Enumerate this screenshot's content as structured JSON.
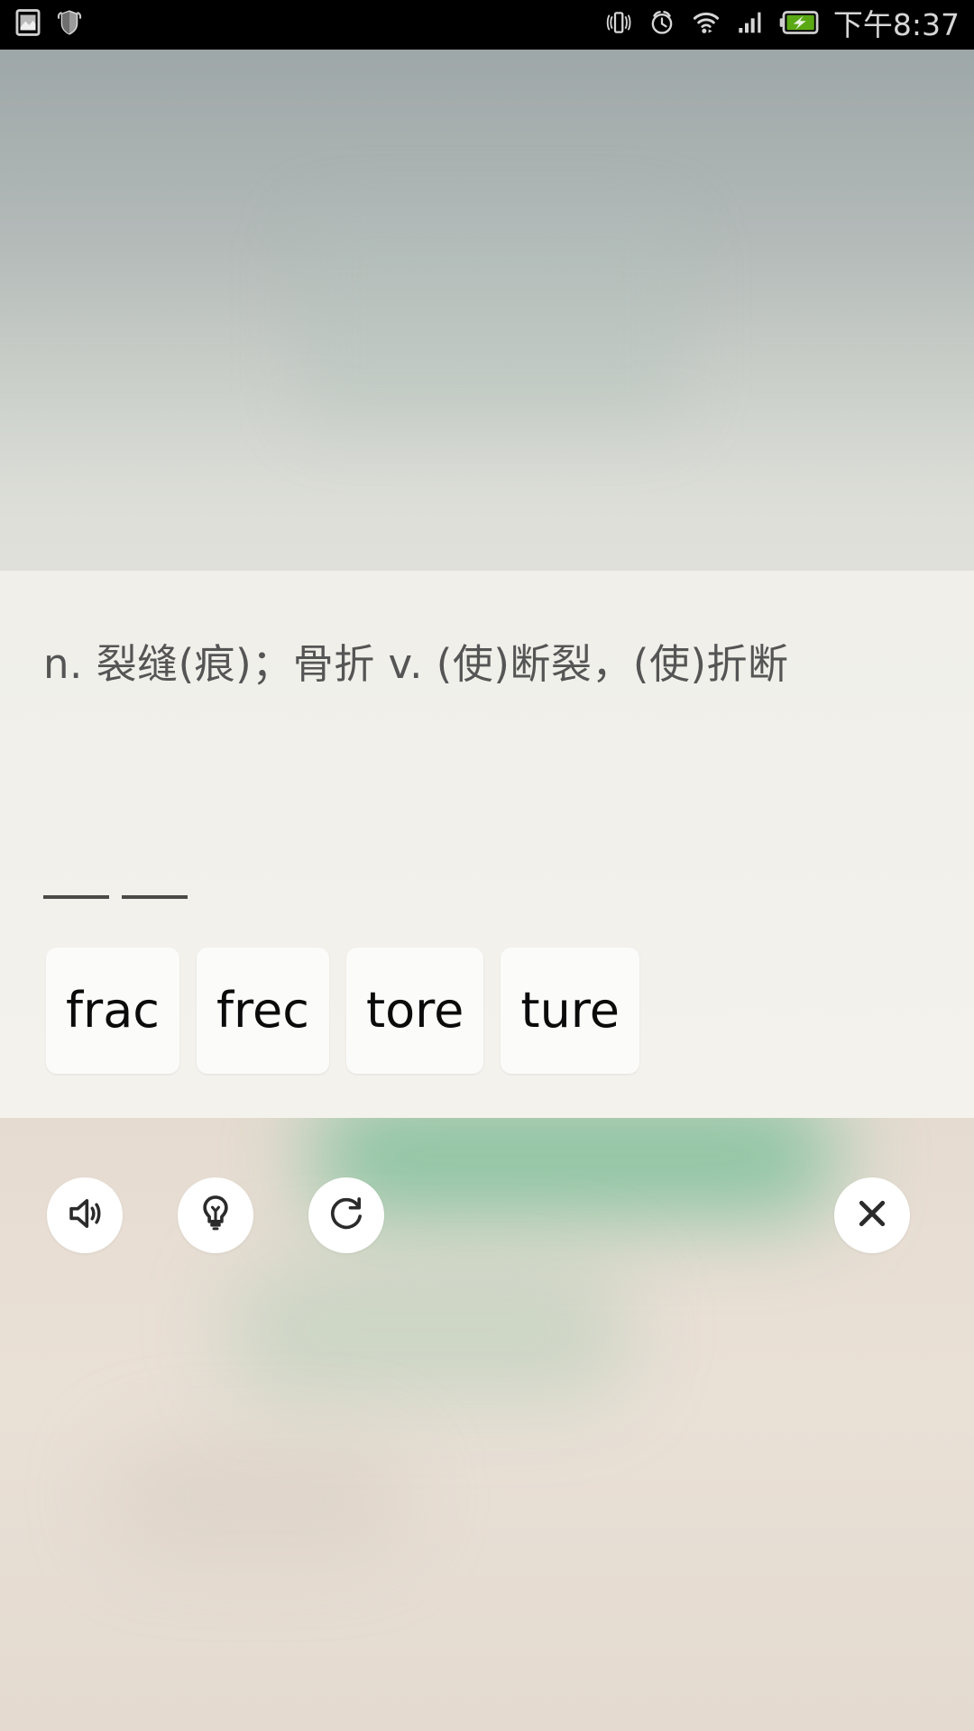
{
  "status_bar": {
    "left_icons": [
      {
        "name": "screenshot-image-icon",
        "glyph": "image"
      },
      {
        "name": "security-shield-icon",
        "glyph": "shield"
      }
    ],
    "right_icons": [
      {
        "name": "vibrate-icon",
        "glyph": "vibrate"
      },
      {
        "name": "alarm-clock-icon",
        "glyph": "alarm"
      },
      {
        "name": "wifi-icon",
        "glyph": "wifi"
      },
      {
        "name": "cellular-signal-icon",
        "glyph": "signal"
      },
      {
        "name": "battery-charging-icon",
        "glyph": "battery-charging"
      }
    ],
    "time": "下午8:37",
    "battery_color": "#5aa814",
    "text_color": "#d6d6d6"
  },
  "quiz": {
    "definition": "n. 裂缝(痕)；骨折  v. (使)断裂，(使)折断",
    "answer_slots": [
      "",
      ""
    ],
    "options": [
      {
        "label": "frac"
      },
      {
        "label": "frec"
      },
      {
        "label": "tore"
      },
      {
        "label": "ture"
      }
    ]
  },
  "toolbar": {
    "buttons": [
      {
        "name": "sound-button",
        "icon": "speaker-icon",
        "label": "播放发音"
      },
      {
        "name": "hint-button",
        "icon": "lightbulb-icon",
        "label": "提示"
      },
      {
        "name": "replay-button",
        "icon": "refresh-icon",
        "label": "重做"
      },
      {
        "name": "close-button",
        "icon": "close-icon",
        "label": "关闭"
      }
    ]
  },
  "theme": {
    "panel_bg": "#f2f0ea",
    "toolbar_bg": "#e7ded4",
    "tile_bg": "#fbfbfa",
    "tile_text": "#0b0b0b",
    "definition_text": "#555555",
    "accent_green": "#76be96"
  }
}
